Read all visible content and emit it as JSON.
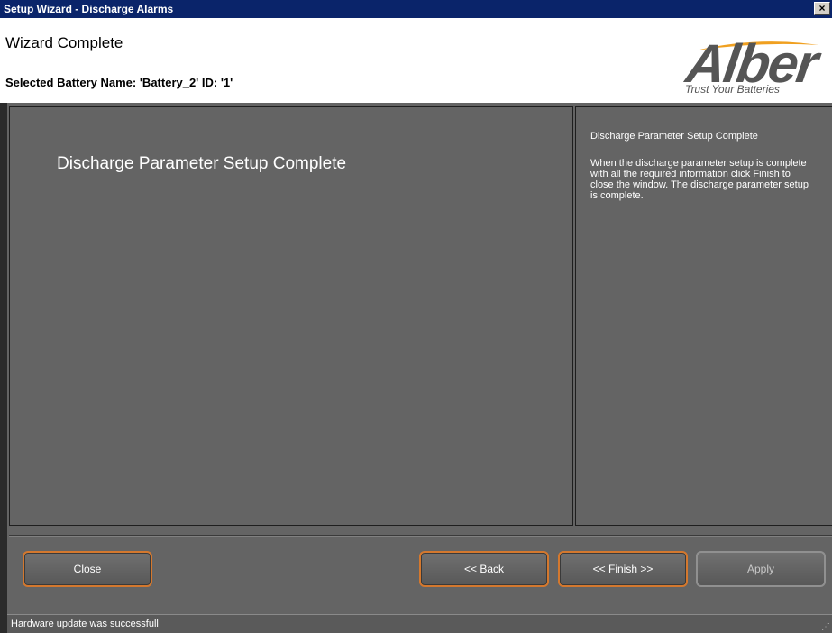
{
  "window": {
    "title": "Setup Wizard - Discharge Alarms",
    "close_glyph": "×"
  },
  "header": {
    "title": "Wizard Complete",
    "battery_label": "Selected Battery Name: 'Battery_2' ID: '1'"
  },
  "logo": {
    "wordmark": "Alber",
    "tagline": "Trust Your Batteries"
  },
  "main": {
    "heading": "Discharge Parameter Setup Complete"
  },
  "help": {
    "title": "Discharge Parameter Setup Complete",
    "body": "When the discharge parameter setup is complete with all the required information click Finish to close the window. The discharge parameter setup is complete."
  },
  "buttons": {
    "close": "Close",
    "back": "<< Back",
    "finish": "<< Finish >>",
    "apply": "Apply"
  },
  "status": {
    "text": "Hardware update was successfull"
  },
  "colors": {
    "titlebar": "#0a246a",
    "panel": "#646464",
    "button_accent": "#d4782e",
    "logo_swoosh": "#f0a020"
  }
}
